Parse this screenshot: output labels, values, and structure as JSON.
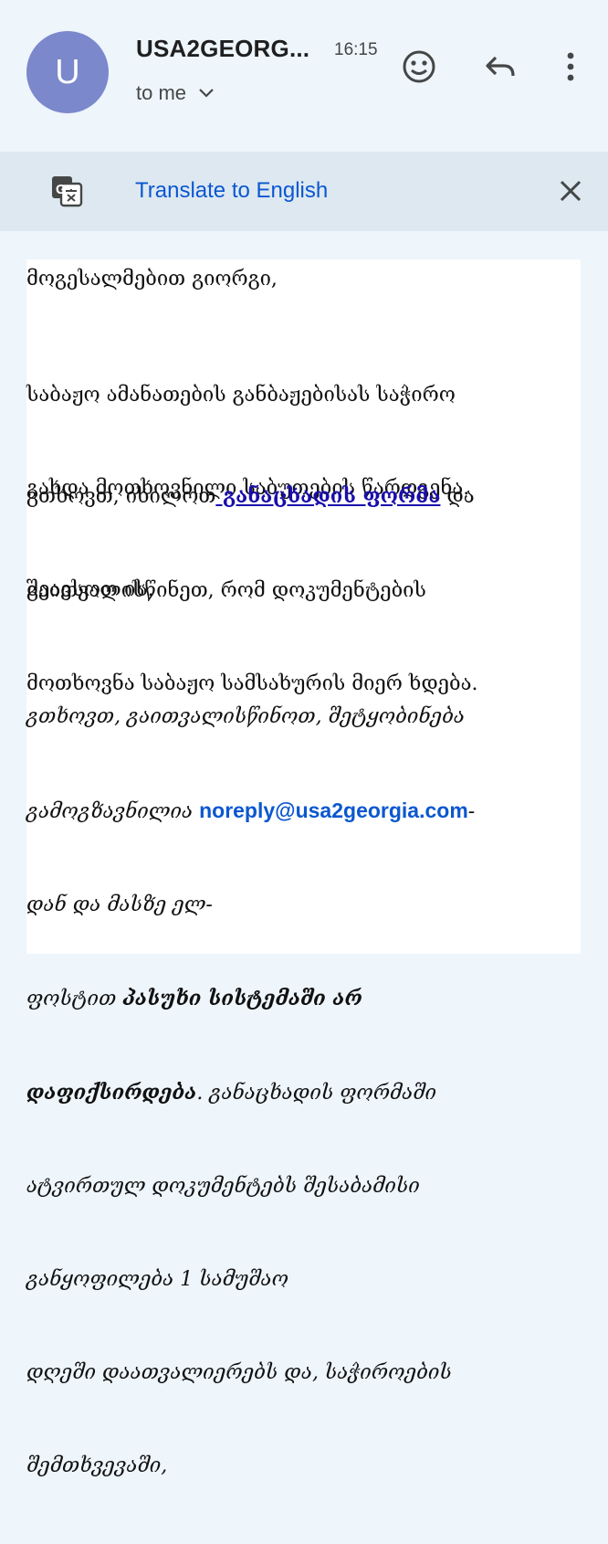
{
  "header": {
    "avatar_letter": "U",
    "sender": "USA2GEORG...",
    "time": "16:15",
    "recipient": "to me",
    "icons": [
      "emoji-icon",
      "reply-icon",
      "more-vert-icon",
      "chevron-down-icon"
    ]
  },
  "translate": {
    "label": "Translate to English",
    "icons": [
      "google-translate-icon",
      "close-icon"
    ]
  },
  "body": {
    "greeting": "მოგესალმებით გიორგი,",
    "para1_line1": "საბაჟო ამანათების განბაჟებისას საჭირო",
    "para1_line2": "გახდა მოთხოვნილი საბუთების წარდგენა.",
    "para2_prefix": "გთხოვთ, იხილოთ",
    "para2_link": " განაცხადის ფორმა",
    "para2_suffix": " და",
    "para2_line2": "შეავსოთ ის.",
    "para3_line1": "გაითვალისწინეთ, რომ დოკუმენტების",
    "para3_line2": "მოთხოვნა საბაჟო სამსახურის მიერ ხდება.",
    "note_line1": "გთხოვთ, გაითვალისწინოთ, შეტყობინება",
    "note_line2_prefix": "გამოგზავნილია ",
    "note_email": "noreply@usa2georgia.com",
    "note_line2_suffix": "-",
    "note_line3": "დან და მასზე ელ-",
    "note_line4_prefix": "ფოსტით ",
    "note_line4_bold": "პასუხი სისტემაში არ",
    "note_line5_bold": "დაფიქსირდება",
    "note_line5_suffix": ". განაცხადის ფორმაში",
    "note_line6": "ატვირთულ დოკუმენტებს შესაბამისი",
    "note_line7": "განყოფილება 1 სამუშაო",
    "note_line8": "დღეში დაათვალიერებს და, საჭიროების",
    "note_line9": "შემთხვევაში,"
  }
}
